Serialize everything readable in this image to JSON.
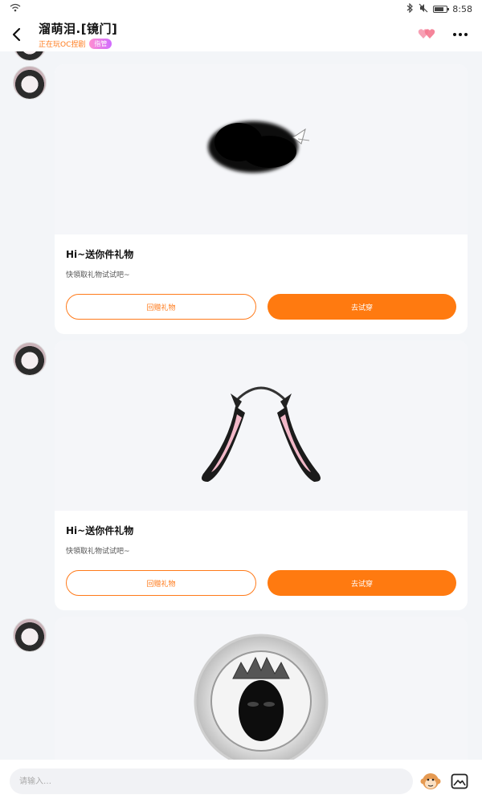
{
  "status_bar": {
    "time": "8:58"
  },
  "header": {
    "title": "溜萌泪.[镜门]",
    "subtitle": "正在玩OC捏剧",
    "tag": "指管",
    "icons": {
      "back": "back-arrow-icon",
      "hearts": "hearts-icon",
      "more": "more-dots-icon"
    }
  },
  "messages": [
    {
      "image": "black-hair-item",
      "title": "Hi~送你件礼物",
      "desc": "快領取礼物试试吧~",
      "btn_gift_back": "回赠礼物",
      "btn_try": "去试穿"
    },
    {
      "image": "bunny-ears-headband",
      "title": "Hi~送你件礼物",
      "desc": "快領取礼物试试吧~",
      "btn_gift_back": "回赠礼物",
      "btn_try": "去试穿"
    },
    {
      "image": "crowned-mask-frame"
    }
  ],
  "composer": {
    "placeholder": "请输入…",
    "icons": {
      "emoji": "monkey-emoji-icon",
      "image": "image-picker-icon"
    }
  },
  "colors": {
    "accent": "#ff7a10",
    "background": "#f3f5f8",
    "card": "#ffffff"
  }
}
